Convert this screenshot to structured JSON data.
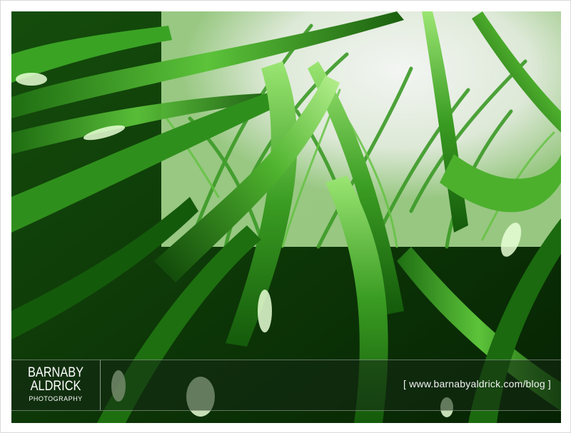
{
  "photo": {
    "subject": "green-leaves-icon"
  },
  "watermark": {
    "logo_line1": "BARNABY",
    "logo_line2": "ALDRICK",
    "logo_line3": "PHOTOGRAPHY",
    "url": "[ www.barnabyaldrick.com/blog ]"
  },
  "colors": {
    "frame": "#ffffff",
    "leaf_dark": "#0b3a08",
    "leaf_mid": "#2f8f1c",
    "leaf_light": "#8fe06a",
    "sky": "#f4f7f2"
  }
}
